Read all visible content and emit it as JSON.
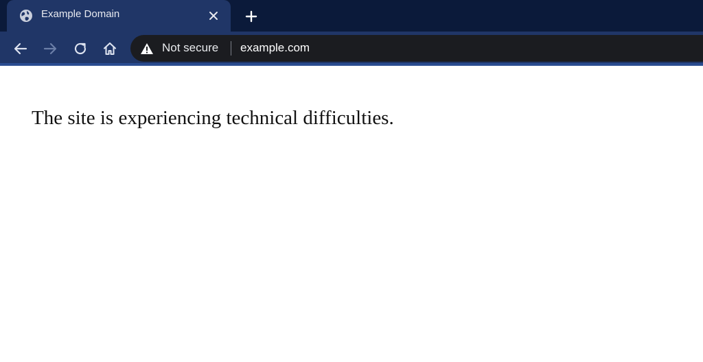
{
  "tab": {
    "title": "Example Domain",
    "favicon": "globe-icon"
  },
  "toolbar": {
    "back_icon": "arrow-left-icon",
    "forward_icon": "arrow-right-icon",
    "reload_icon": "reload-icon",
    "home_icon": "home-icon"
  },
  "omnibox": {
    "security_icon": "warning-icon",
    "security_label": "Not secure",
    "url": "example.com"
  },
  "page": {
    "message": "The site is experiencing technical difficulties."
  },
  "colors": {
    "tab_strip_bg": "#0b1a3a",
    "active_tab_bg": "#203667",
    "omnibox_bg": "#1b1c20",
    "page_bg": "#ffffff"
  }
}
